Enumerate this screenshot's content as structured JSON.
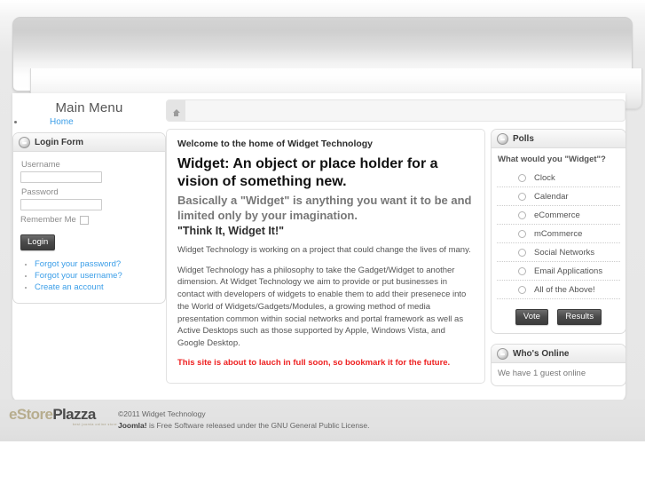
{
  "site": {
    "header_title": ""
  },
  "breadcrumb": {
    "home_icon": "home-icon",
    "path": ""
  },
  "sidebar_left": {
    "menu_title": "Main Menu",
    "menu_items": [
      {
        "label": "Home"
      }
    ],
    "login_module": {
      "title": "Login Form",
      "icon": "module-toggle-icon",
      "username_label": "Username",
      "username_value": "",
      "password_label": "Password",
      "password_value": "",
      "remember_label": "Remember Me",
      "remember_checked": false,
      "login_button": "Login",
      "links": [
        {
          "label": "Forgot your password?"
        },
        {
          "label": "Forgot your username?"
        },
        {
          "label": "Create an account"
        }
      ]
    }
  },
  "main": {
    "welcome": "Welcome to the home of Widget Technology",
    "heading": "Widget: An object or place holder for a vision of something new.",
    "subheading": "Basically a \"Widget\" is anything you want it to be and limited only by your imagination.",
    "tagline": "\"Think It, Widget It!\"",
    "paragraph1": "Widget Technology is working on a project that could change the lives of many.",
    "paragraph2": "Widget Technology has a philosophy to take the Gadget/Widget to another dimension. At Widget Technology we aim to provide or put businesses in contact with developers of widgets to enable them to add their presenece into the World of Widgets/Gadgets/Modules, a growing method of media presentation common within social networks and portal framework as well as Active Desktops such as those supported by Apple, Windows Vista, and Google Desktop.",
    "notice": "This site is about to lauch in full soon, so bookmark it for the future."
  },
  "sidebar_right": {
    "polls_module": {
      "title": "Polls",
      "icon": "module-toggle-icon",
      "question": "What would you \"Widget\"?",
      "options": [
        {
          "label": "Clock"
        },
        {
          "label": "Calendar"
        },
        {
          "label": "eCommerce"
        },
        {
          "label": "mCommerce"
        },
        {
          "label": "Social Networks"
        },
        {
          "label": "Email Applications"
        },
        {
          "label": "All of the Above!"
        }
      ],
      "vote_button": "Vote",
      "results_button": "Results"
    },
    "online_module": {
      "title": "Who's Online",
      "icon": "module-toggle-icon",
      "text": "We have 1 guest online"
    }
  },
  "footer": {
    "logo": {
      "part1": "eStore",
      "part2": "Plazza",
      "tagline": "best joomla online store"
    },
    "copyright": "©2011 Widget Technology",
    "license_brand": "Joomla!",
    "license_text": " is Free Software released under the GNU General Public License."
  },
  "colors": {
    "link": "#3b9ee8",
    "notice": "#ee2222",
    "logo_accent": "#b7ad8e",
    "logo_dark": "#4b4b4b"
  }
}
